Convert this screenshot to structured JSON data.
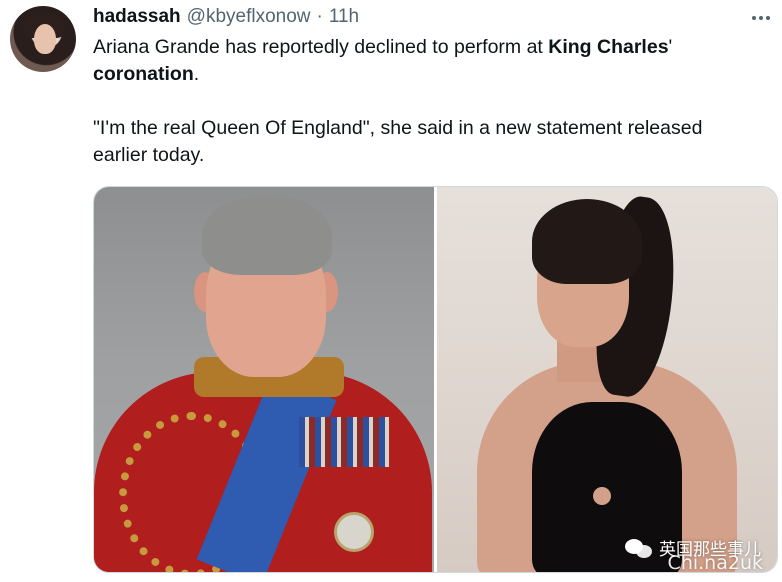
{
  "tweet": {
    "author_name": "hadassah",
    "handle": "@kbyeflxonow",
    "separator": "·",
    "time": "11h",
    "text_part1": "Ariana Grande has reportedly declined to perform at ",
    "text_bold1": "King Charles",
    "text_part2": "' ",
    "text_bold2": "coronation",
    "text_part3": ".",
    "quote": "\"I'm the real Queen Of England\", she said in a new statement released earlier today."
  },
  "media": {
    "watermark": "英国那些事儿",
    "watermark_sub": "Chi.na2uk"
  },
  "icons": {
    "more": "more-horizontal-icon",
    "watermark": "wechat-icon"
  },
  "colors": {
    "text_primary": "#0f1419",
    "text_secondary": "#536471",
    "border": "#cfd9de"
  }
}
